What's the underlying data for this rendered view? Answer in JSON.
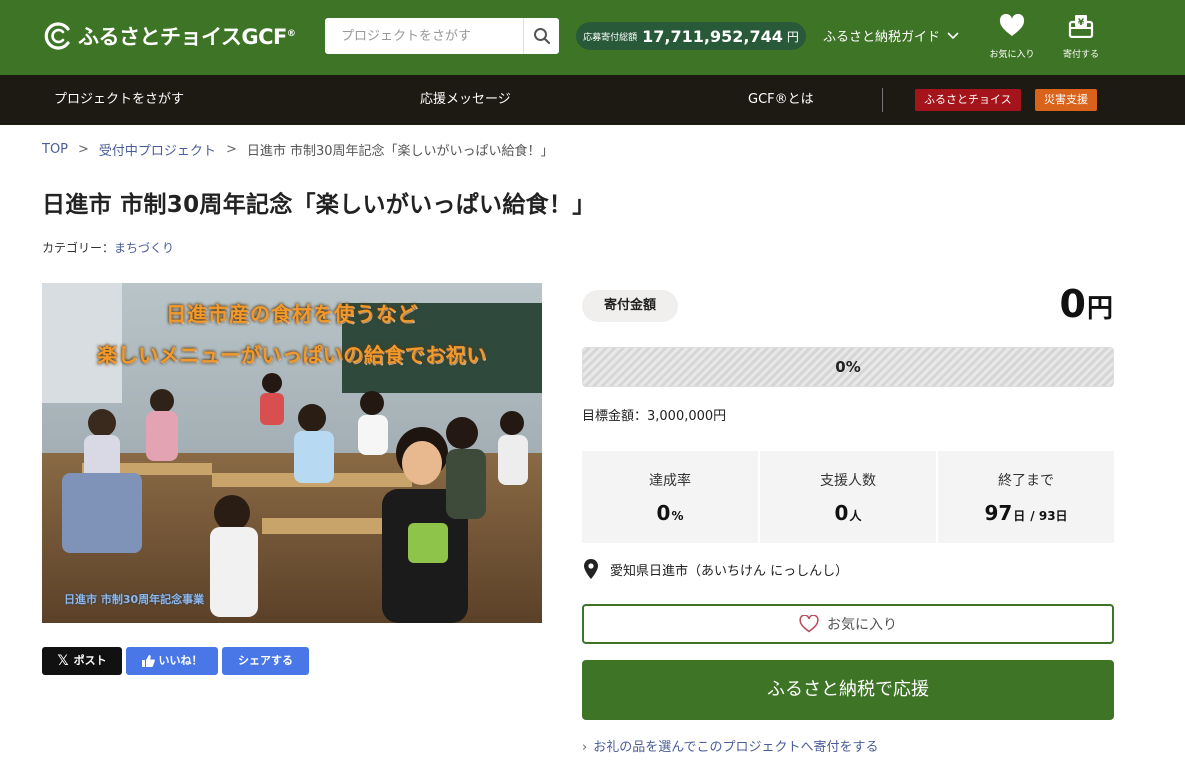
{
  "header": {
    "logo_text": "ふるさとチョイスGCF",
    "logo_reg": "®",
    "search_placeholder": "プロジェクトをさがす",
    "total_label": "応募寄付総額",
    "total_amount": "17,711,952,744",
    "total_unit": "円",
    "guide_label": "ふるさと納税ガイド",
    "favorites_label": "お気に入り",
    "donate_label": "寄付する"
  },
  "nav": {
    "items": [
      "プロジェクトをさがす",
      "応援メッセージ",
      "GCF®とは"
    ],
    "badge_choice": "ふるさとチョイス",
    "badge_disaster": "災害支援",
    "badge_choice_color": "#a5141b",
    "badge_disaster_color": "#d9631b"
  },
  "breadcrumb": [
    "TOP",
    "受付中プロジェクト",
    "日進市 市制30周年記念「楽しいがいっぱい給食！」"
  ],
  "breadcrumb_sep": ">",
  "project": {
    "title": "日進市 市制30周年記念「楽しいがいっぱい給食！」",
    "category_label": "カテゴリー：",
    "category": "まちづくり"
  },
  "image": {
    "caption_line1": "日進市産の食材を使うなど",
    "caption_line2": "楽しいメニューがいっぱいの給食でお祝い",
    "caption_footer": "日進市 市制30周年記念事業"
  },
  "share": {
    "post": "ポスト",
    "like": "いいね！",
    "share": "シェアする"
  },
  "donation": {
    "amount_label": "寄付金額",
    "amount": "0",
    "amount_unit": "円",
    "progress_label": "0%",
    "progress_fraction": 0,
    "goal": "目標金額：3,000,000円",
    "stats": {
      "rate_label": "達成率",
      "rate_value": "0",
      "rate_unit": "%",
      "supporters_label": "支援人数",
      "supporters_value": "0",
      "supporters_unit": "人",
      "remaining_label": "終了まで",
      "remaining_value": "97",
      "remaining_unit": "日",
      "remaining_total": "/ 93日"
    },
    "location": "愛知県日進市（あいちけん にっしんし）",
    "favorite_button": "お気に入り",
    "support_button": "ふるさと納税で応援",
    "gift_link": "お礼の品を選んでこのプロジェクトへ寄付をする"
  },
  "colors": {
    "brand_green": "#3e7426",
    "nav_dark": "#1d1a13",
    "pill_green": "#285a3a",
    "link_blue": "#4a5d9a",
    "share_blue": "#4a77e8"
  }
}
